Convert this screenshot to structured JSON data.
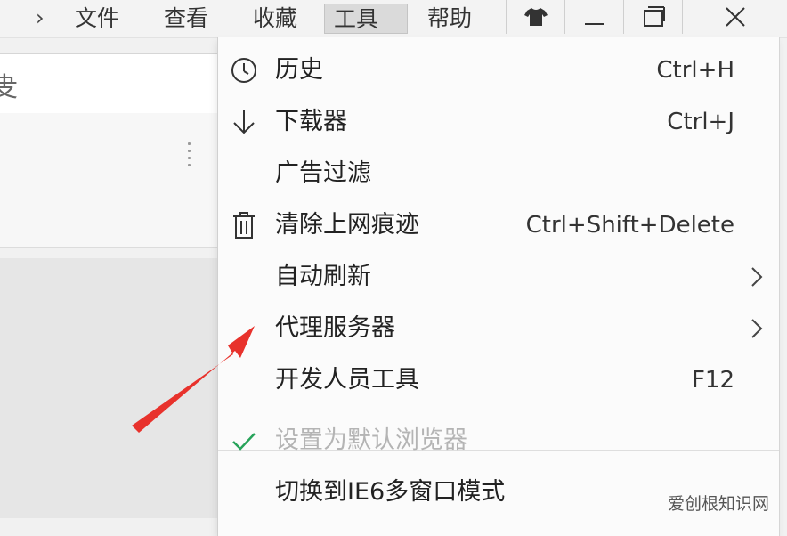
{
  "menubar": {
    "items": [
      {
        "label": "文件"
      },
      {
        "label": "查看"
      },
      {
        "label": "收藏"
      },
      {
        "label": "工具"
      },
      {
        "label": "帮助"
      }
    ]
  },
  "address": {
    "fragment": "叏"
  },
  "dropdown": {
    "items": [
      {
        "label": "历史",
        "shortcut": "Ctrl+H",
        "icon": "clock-icon"
      },
      {
        "label": "下载器",
        "shortcut": "Ctrl+J",
        "icon": "download-arrow-icon"
      },
      {
        "label": "广告过滤",
        "shortcut": "",
        "icon": ""
      },
      {
        "label": "清除上网痕迹",
        "shortcut": "Ctrl+Shift+Delete",
        "icon": "trash-icon"
      },
      {
        "label": "自动刷新",
        "shortcut": "",
        "submenu": true
      },
      {
        "label": "代理服务器",
        "shortcut": "",
        "submenu": true
      },
      {
        "label": "开发人员工具",
        "shortcut": "F12"
      },
      {
        "label": "设置为默认浏览器",
        "shortcut": "",
        "icon": "checkmark-icon",
        "disabled": true
      },
      {
        "label": "切换到IE6多窗口模式",
        "shortcut": ""
      }
    ]
  },
  "watermark": {
    "text": "爱创根知识网"
  },
  "colors": {
    "arrow": "#e8322c",
    "check": "#27a35a"
  }
}
